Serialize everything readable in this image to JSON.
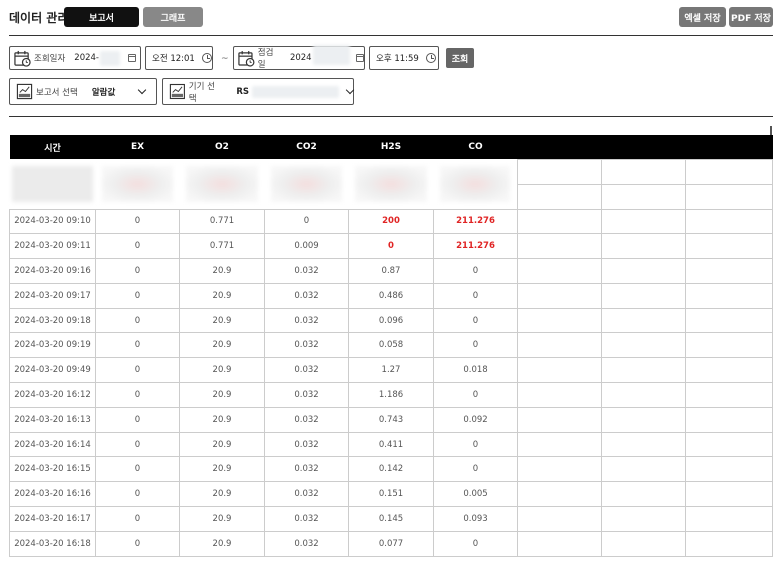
{
  "header": {
    "title": "데이터 관리",
    "tabs": [
      {
        "label": "보고서",
        "active": true
      },
      {
        "label": "그래프",
        "active": false
      }
    ],
    "excel_button": "엑셀 저장",
    "pdf_button": "PDF 저장"
  },
  "filters": {
    "start_label": "조회일자",
    "start_date": "2024-",
    "start_time": "오전 12:01",
    "separator": "~",
    "end_label": "점검일",
    "end_date": "2024",
    "end_time": "오후 11:59",
    "search_button": "조회",
    "report_label": "보고서 선택",
    "report_value": "알람값",
    "device_label": "기기 선택",
    "device_value": "RS"
  },
  "colors": {
    "header_bg": "#000000",
    "alarm_red": "#e02424",
    "tab_active": "#111111",
    "tab_inactive": "#888888"
  },
  "table": {
    "columns": [
      "시간",
      "EX",
      "O2",
      "CO2",
      "H2S",
      "CO"
    ],
    "rows": [
      [
        "2024-03-20 09:10",
        "0",
        "0.771",
        "0",
        "200",
        "211.276"
      ],
      [
        "2024-03-20 09:11",
        "0",
        "0.771",
        "0.009",
        "0",
        "211.276"
      ],
      [
        "2024-03-20 09:16",
        "0",
        "20.9",
        "0.032",
        "0.87",
        "0"
      ],
      [
        "2024-03-20 09:17",
        "0",
        "20.9",
        "0.032",
        "0.486",
        "0"
      ],
      [
        "2024-03-20 09:18",
        "0",
        "20.9",
        "0.032",
        "0.096",
        "0"
      ],
      [
        "2024-03-20 09:19",
        "0",
        "20.9",
        "0.032",
        "0.058",
        "0"
      ],
      [
        "2024-03-20 09:49",
        "0",
        "20.9",
        "0.032",
        "1.27",
        "0.018"
      ],
      [
        "2024-03-20 16:12",
        "0",
        "20.9",
        "0.032",
        "1.186",
        "0"
      ],
      [
        "2024-03-20 16:13",
        "0",
        "20.9",
        "0.032",
        "0.743",
        "0.092"
      ],
      [
        "2024-03-20 16:14",
        "0",
        "20.9",
        "0.032",
        "0.411",
        "0"
      ],
      [
        "2024-03-20 16:15",
        "0",
        "20.9",
        "0.032",
        "0.142",
        "0"
      ],
      [
        "2024-03-20 16:16",
        "0",
        "20.9",
        "0.032",
        "0.151",
        "0.005"
      ],
      [
        "2024-03-20 16:17",
        "0",
        "20.9",
        "0.032",
        "0.145",
        "0.093"
      ],
      [
        "2024-03-20 16:18",
        "0",
        "20.9",
        "0.032",
        "0.077",
        "0"
      ]
    ],
    "red_cells": [
      [
        0,
        4
      ],
      [
        0,
        5
      ],
      [
        1,
        4
      ],
      [
        1,
        5
      ]
    ]
  }
}
